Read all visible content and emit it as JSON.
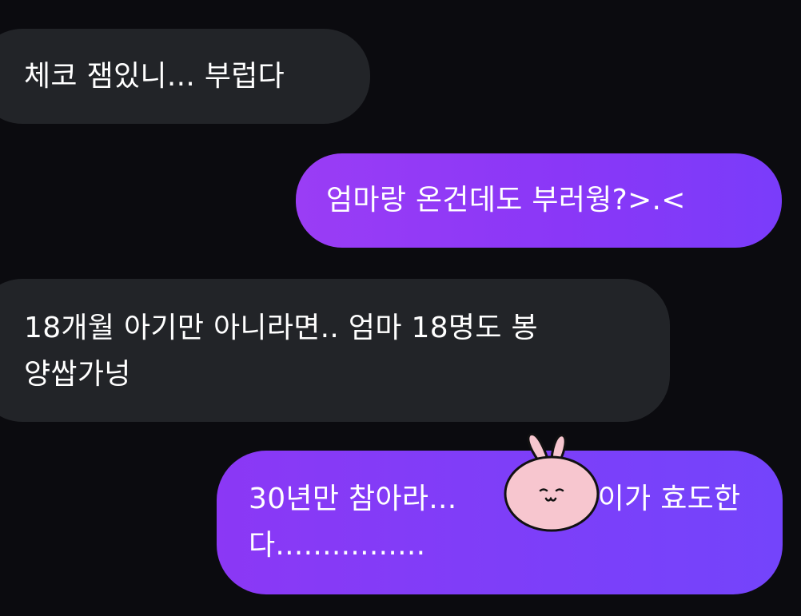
{
  "messages": [
    {
      "side": "received",
      "lines": [
        "체코 잼있니... 부럽다"
      ]
    },
    {
      "side": "sent",
      "lines": [
        "엄마랑 온건데도 부러웡?>.<"
      ]
    },
    {
      "side": "received",
      "lines": [
        "18개월 아기만 아니라면.. 엄마 18명도 봉",
        "양쌉가넝"
      ]
    },
    {
      "side": "sent",
      "lines": [
        "30년만 참아라...               이가 효도한",
        "다................"
      ]
    }
  ],
  "sticker": {
    "icon": "bunny-face-sticker",
    "color": "#f7c6cf"
  },
  "colors": {
    "background": "#0b0b0f",
    "received_bubble": "#222428",
    "sent_bubble_start": "#9a3df5",
    "sent_bubble_end": "#7444fb",
    "text": "#ffffff"
  }
}
